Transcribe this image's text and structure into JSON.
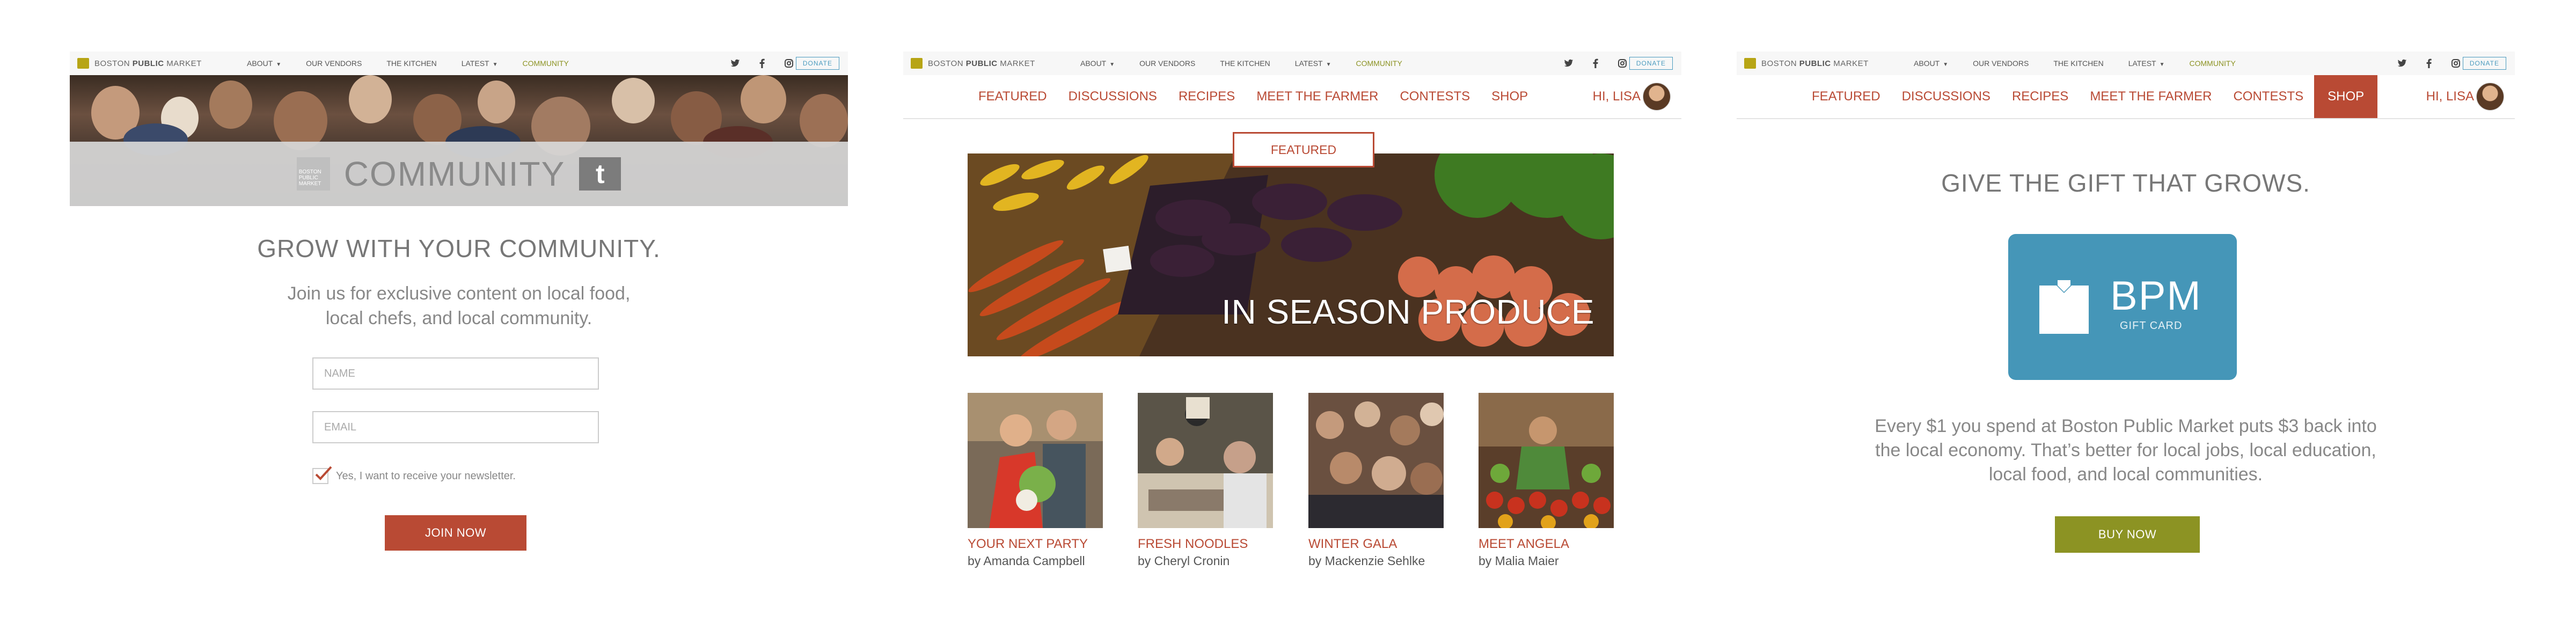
{
  "nav": {
    "brand_pre": "BOSTON",
    "brand_bold": "PUBLIC",
    "brand_post": "MARKET",
    "links": [
      "ABOUT",
      "OUR VENDORS",
      "THE KITCHEN",
      "LATEST",
      "COMMUNITY"
    ],
    "donate": "DONATE",
    "social_icons": [
      "twitter-icon",
      "facebook-icon",
      "instagram-icon"
    ]
  },
  "subnav": {
    "items": [
      "FEATURED",
      "DISCUSSIONS",
      "RECIPES",
      "MEET THE FARMER",
      "CONTESTS",
      "SHOP"
    ],
    "greeting": "HI, LISA"
  },
  "panel1": {
    "hero_title": "COMMUNITY",
    "hero_logo_text": "BOSTON PUBLIC MARKET",
    "tumblr_glyph": "t",
    "heading": "GROW WITH YOUR COMMUNITY.",
    "subtext": "Join us for exclusive content on local food, local chefs, and local community.",
    "name_placeholder": "NAME",
    "email_placeholder": "EMAIL",
    "newsletter_label": "Yes, I want to receive your newsletter.",
    "newsletter_checked": true,
    "join_button": "JOIN NOW"
  },
  "panel2": {
    "featured_tag": "FEATURED",
    "hero_caption": "IN SEASON PRODUCE",
    "cards": [
      {
        "title": "YOUR NEXT PARTY",
        "author": "by Amanda Campbell"
      },
      {
        "title": "FRESH NOODLES",
        "author": "by Cheryl Cronin"
      },
      {
        "title": "WINTER GALA",
        "author": "by Mackenzie Sehlke"
      },
      {
        "title": "MEET ANGELA",
        "author": "by Malia Maier"
      }
    ]
  },
  "panel3": {
    "heading": "GIVE THE GIFT THAT GROWS.",
    "card_title": "BPM",
    "card_subtitle": "GIFT CARD",
    "body": "Every $1 you spend at Boston Public Market puts $3 back into the local economy. That’s better for local jobs, local education, local food, and local communities.",
    "buy_button": "BUY NOW"
  },
  "colors": {
    "accent_red": "#b94a34",
    "accent_green": "#8c9323",
    "gift_blue": "#4596b8",
    "donate_blue": "#4a9bbf",
    "logo_gold": "#b7a515"
  }
}
